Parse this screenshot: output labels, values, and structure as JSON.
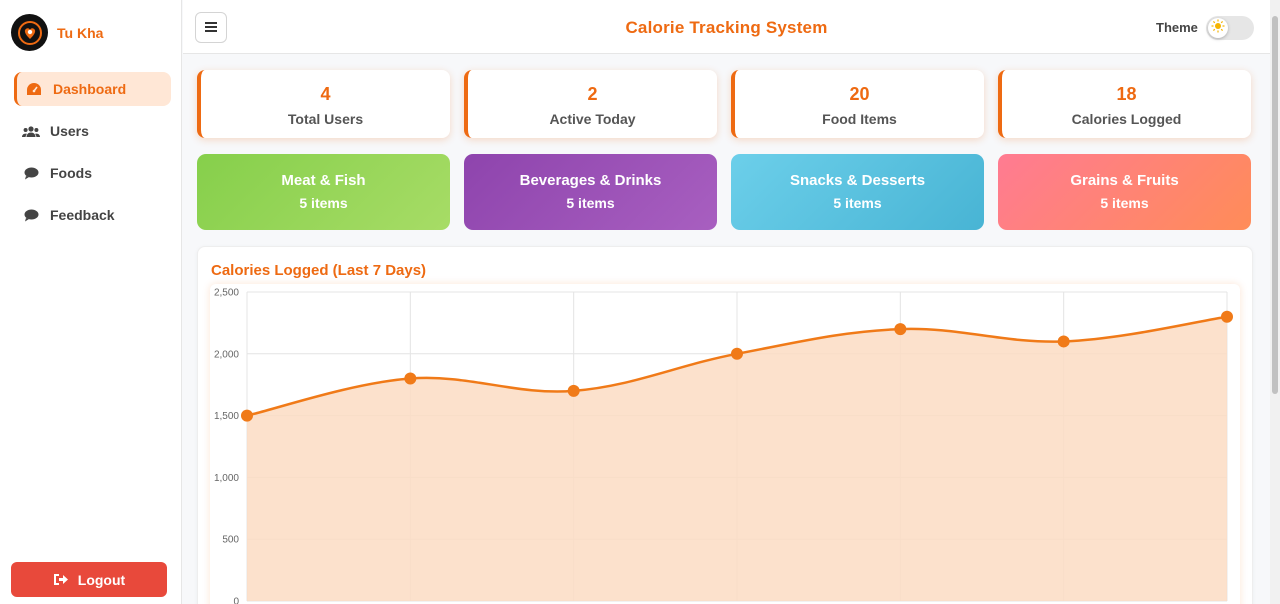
{
  "sidebar": {
    "brand": "Tu Kha",
    "items": [
      {
        "label": "Dashboard",
        "icon": "dashboard-icon",
        "active": true
      },
      {
        "label": "Users",
        "icon": "users-icon",
        "active": false
      },
      {
        "label": "Foods",
        "icon": "comment-icon",
        "active": false
      },
      {
        "label": "Feedback",
        "icon": "comment-icon",
        "active": false
      }
    ],
    "logout_label": "Logout"
  },
  "header": {
    "title": "Calorie Tracking System",
    "theme_label": "Theme"
  },
  "stats": [
    {
      "value": "4",
      "label": "Total Users"
    },
    {
      "value": "2",
      "label": "Active Today"
    },
    {
      "value": "20",
      "label": "Food Items"
    },
    {
      "value": "18",
      "label": "Calories Logged"
    }
  ],
  "categories": [
    {
      "name": "Meat & Fish",
      "count": "5 items"
    },
    {
      "name": "Beverages & Drinks",
      "count": "5 items"
    },
    {
      "name": "Snacks & Desserts",
      "count": "5 items"
    },
    {
      "name": "Grains & Fruits",
      "count": "5 items"
    }
  ],
  "colors": {
    "accent": "#ee6a12",
    "logout": "#e8493b",
    "meat": [
      "#8bd14f",
      "#a5da63"
    ],
    "beverages": [
      "#8e44ad",
      "#a55bbf"
    ],
    "snacks": [
      "#63cbe8",
      "#4bb7d6"
    ],
    "grains": [
      "#ff7e8f",
      "#ff8c5a"
    ]
  },
  "chart_data": {
    "type": "line",
    "title": "Calories Logged (Last 7 Days)",
    "x": [
      1,
      2,
      3,
      4,
      5,
      6,
      7
    ],
    "values": [
      1500,
      1800,
      1700,
      2000,
      2200,
      2100,
      2300
    ],
    "ylim": [
      0,
      2500
    ],
    "yticks": [
      "0",
      "500",
      "1,000",
      "1,500",
      "2,000",
      "2,500"
    ],
    "fill": true,
    "grid": true,
    "line_color": "#f07a18",
    "fill_color": "#fcdcc3"
  }
}
